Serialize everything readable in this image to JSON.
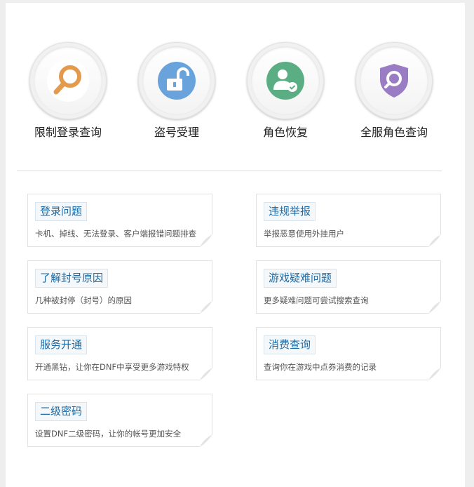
{
  "quick_actions": [
    {
      "label": "限制登录查询",
      "icon": "search-icon",
      "color": "#e49a4d"
    },
    {
      "label": "盗号受理",
      "icon": "unlock-icon",
      "color": "#6aa2dc"
    },
    {
      "label": "角色恢复",
      "icon": "user-check-icon",
      "color": "#5bae84"
    },
    {
      "label": "全服角色查询",
      "icon": "shield-search-icon",
      "color": "#9a7cc5"
    }
  ],
  "cards": [
    {
      "title": "登录问题",
      "desc": "卡机、掉线、无法登录、客户端报错问题排查"
    },
    {
      "title": "违规举报",
      "desc": "举报恶意使用外挂用户"
    },
    {
      "title": "了解封号原因",
      "desc": "几种被封停（封号）的原因"
    },
    {
      "title": "游戏疑难问题",
      "desc": "更多疑难问题可尝试搜索查询"
    },
    {
      "title": "服务开通",
      "desc": "开通黑钻，让你在DNF中享受更多游戏特权"
    },
    {
      "title": "消费查询",
      "desc": "查询你在游戏中点券消费的记录"
    },
    {
      "title": "二级密码",
      "desc": "设置DNF二级密码，让你的帐号更加安全"
    }
  ],
  "colors": {
    "card_title_text": "#1d6aa5",
    "card_title_bg": "#f4f8fb"
  }
}
